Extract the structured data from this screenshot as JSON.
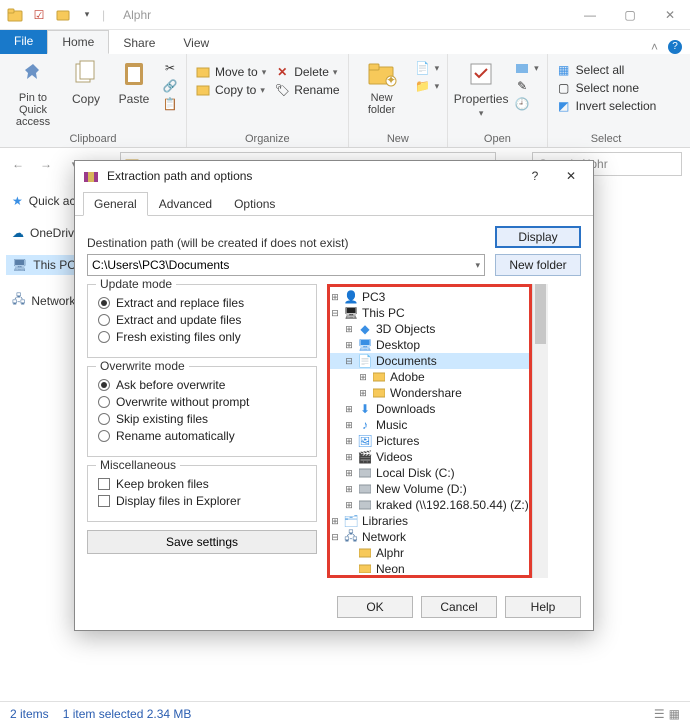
{
  "window": {
    "title": "Alphr",
    "minimize": "—",
    "maximize": "▢",
    "close": "✕"
  },
  "ribbon_tabs": {
    "file": "File",
    "home": "Home",
    "share": "Share",
    "view": "View"
  },
  "ribbon": {
    "pin": "Pin to Quick access",
    "copy": "Copy",
    "paste": "Paste",
    "clipboard_group": "Clipboard",
    "move_to": "Move to",
    "copy_to": "Copy to",
    "delete": "Delete",
    "rename": "Rename",
    "organize_group": "Organize",
    "new_folder": "New folder",
    "new_group": "New",
    "properties": "Properties",
    "open_group": "Open",
    "select_all": "Select all",
    "select_none": "Select none",
    "invert_selection": "Invert selection",
    "select_group": "Select"
  },
  "nav": {
    "back": "←",
    "forward": "→",
    "up": "↑",
    "refresh": "⟳",
    "search_placeholder": "Search Alphr"
  },
  "navpane": {
    "quick": "Quick access",
    "onedrive": "OneDrive",
    "thispc": "This PC",
    "network": "Network"
  },
  "status": {
    "items": "2 items",
    "selected": "1 item selected  2.34 MB"
  },
  "dialog": {
    "title": "Extraction path and options",
    "help": "?",
    "close": "✕",
    "tabs": {
      "general": "General",
      "advanced": "Advanced",
      "options": "Options"
    },
    "dest_label": "Destination path (will be created if does not exist)",
    "dest_value": "C:\\Users\\PC3\\Documents",
    "display": "Display",
    "new_folder": "New folder",
    "update_mode": {
      "legend": "Update mode",
      "o1": "Extract and replace files",
      "o2": "Extract and update files",
      "o3": "Fresh existing files only"
    },
    "overwrite_mode": {
      "legend": "Overwrite mode",
      "o1": "Ask before overwrite",
      "o2": "Overwrite without prompt",
      "o3": "Skip existing files",
      "o4": "Rename automatically"
    },
    "misc": {
      "legend": "Miscellaneous",
      "o1": "Keep broken files",
      "o2": "Display files in Explorer"
    },
    "save": "Save settings",
    "tree": {
      "pc3": "PC3",
      "thispc": "This PC",
      "objects3d": "3D Objects",
      "desktop": "Desktop",
      "documents": "Documents",
      "adobe": "Adobe",
      "wondershare": "Wondershare",
      "downloads": "Downloads",
      "music": "Music",
      "pictures": "Pictures",
      "videos": "Videos",
      "localdisk": "Local Disk (C:)",
      "newvol": "New Volume (D:)",
      "kraked": "kraked (\\\\192.168.50.44) (Z:)",
      "libraries": "Libraries",
      "network": "Network",
      "alphr": "Alphr",
      "neon": "Neon"
    },
    "buttons": {
      "ok": "OK",
      "cancel": "Cancel",
      "help": "Help"
    }
  }
}
